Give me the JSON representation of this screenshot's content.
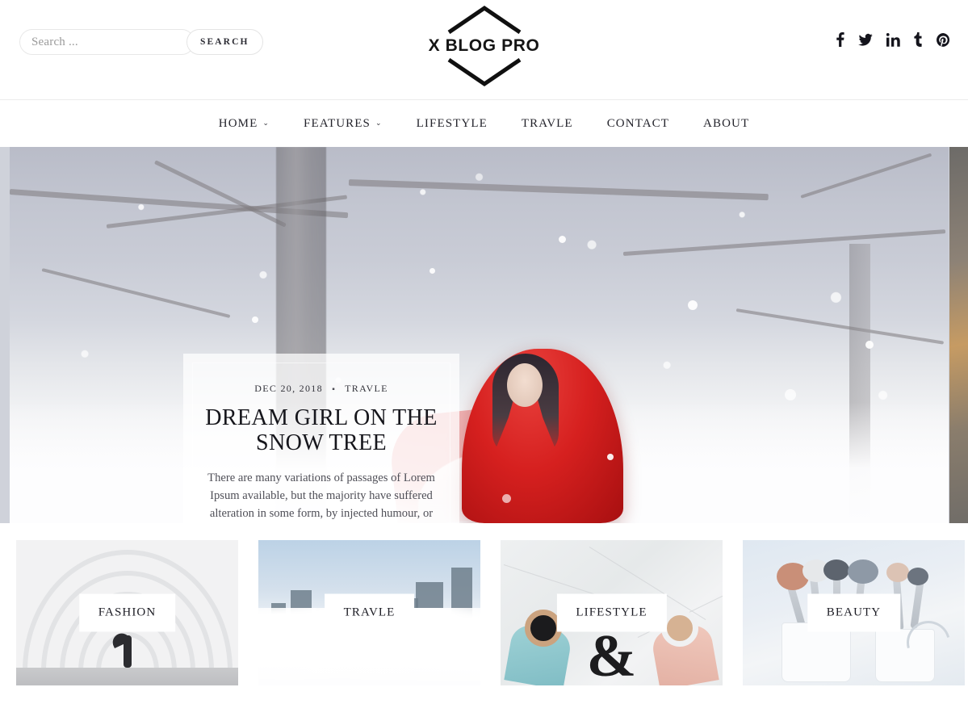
{
  "header": {
    "search": {
      "placeholder": "Search ...",
      "value": "",
      "button_label": "SEARCH"
    },
    "brand": {
      "name": "X BLOG PRO"
    },
    "social": [
      {
        "name": "facebook",
        "label": "f"
      },
      {
        "name": "twitter",
        "label": ""
      },
      {
        "name": "linkedin",
        "label": "in"
      },
      {
        "name": "tumblr",
        "label": "t"
      },
      {
        "name": "pinterest",
        "label": "P"
      }
    ]
  },
  "nav": {
    "items": [
      {
        "label": "HOME",
        "has_dropdown": true
      },
      {
        "label": "FEATURES",
        "has_dropdown": true
      },
      {
        "label": "LIFESTYLE",
        "has_dropdown": false
      },
      {
        "label": "TRAVLE",
        "has_dropdown": false
      },
      {
        "label": "CONTACT",
        "has_dropdown": false
      },
      {
        "label": "ABOUT",
        "has_dropdown": false
      }
    ],
    "caret_glyph": "⌄"
  },
  "hero": {
    "date": "DEC 20, 2018",
    "separator": "▪",
    "category": "TRAVLE",
    "title": "DREAM GIRL ON THE SNOW TREE",
    "excerpt": "There are many variations of passages of Lorem Ipsum available, but the majority have suffered alteration in some form, by injected humour, or randomised words which don't look even slightly believable. If you are going to use a passage of...",
    "format_icons": [
      "document-icon",
      "gallery-icon",
      "images-icon",
      "audio-icon",
      "video-icon"
    ]
  },
  "categories": [
    {
      "label": "FASHION"
    },
    {
      "label": "TRAVLE"
    },
    {
      "label": "LIFESTYLE"
    },
    {
      "label": "BEAUTY"
    }
  ],
  "colors": {
    "text": "#1c1c24",
    "muted": "#8b8b8b",
    "border": "#ececec",
    "accent_red": "#d6201f",
    "background": "#ffffff"
  }
}
